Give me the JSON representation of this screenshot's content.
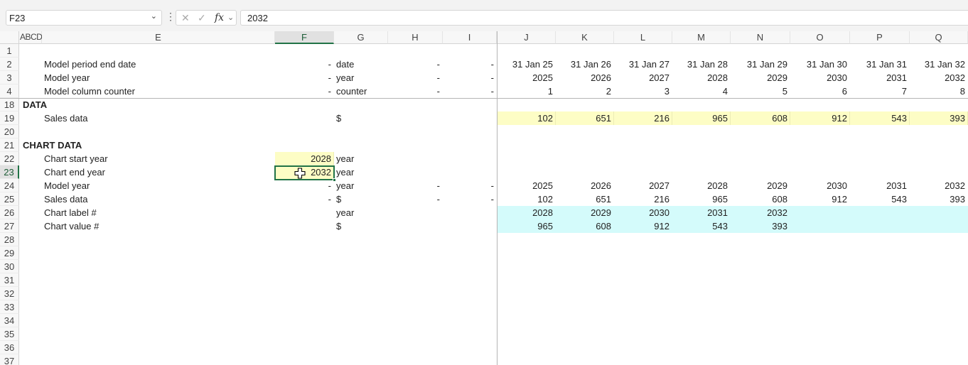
{
  "formula_bar": {
    "name_box": "F23",
    "cancel_glyph": "✕",
    "enter_glyph": "✓",
    "fx_label": "fx",
    "formula_value": "2032"
  },
  "columns": [
    "ABCD",
    "E",
    "F",
    "G",
    "H",
    "I",
    "J",
    "K",
    "L",
    "M",
    "N",
    "O",
    "P",
    "Q"
  ],
  "rows": [
    "1",
    "2",
    "3",
    "4",
    "18",
    "19",
    "20",
    "21",
    "22",
    "23",
    "24",
    "25",
    "26",
    "27",
    "28",
    "29",
    "30",
    "31",
    "32",
    "33",
    "34",
    "35",
    "36",
    "37"
  ],
  "selected": {
    "column": "F",
    "row": "23"
  },
  "sheet": {
    "row2": {
      "label": "Model period end date",
      "f": "-",
      "unit": "date",
      "h": "-",
      "i": "-",
      "values": [
        "31 Jan 25",
        "31 Jan 26",
        "31 Jan 27",
        "31 Jan 28",
        "31 Jan 29",
        "31 Jan 30",
        "31 Jan 31",
        "31 Jan 32"
      ]
    },
    "row3": {
      "label": "Model year",
      "f": "-",
      "unit": "year",
      "h": "-",
      "i": "-",
      "values": [
        "2025",
        "2026",
        "2027",
        "2028",
        "2029",
        "2030",
        "2031",
        "2032"
      ]
    },
    "row4": {
      "label": "Model column counter",
      "f": "-",
      "unit": "counter",
      "h": "-",
      "i": "-",
      "values": [
        "1",
        "2",
        "3",
        "4",
        "5",
        "6",
        "7",
        "8"
      ]
    },
    "row18": {
      "heading": "DATA"
    },
    "row19": {
      "label": "Sales data",
      "unit": "$",
      "values": [
        "102",
        "651",
        "216",
        "965",
        "608",
        "912",
        "543",
        "393"
      ]
    },
    "row21": {
      "heading": "CHART DATA"
    },
    "row22": {
      "label": "Chart start year",
      "f": "2028",
      "unit": "year"
    },
    "row23": {
      "label": "Chart end year",
      "f": "2032",
      "unit": "year"
    },
    "row24": {
      "label": "Model year",
      "f": "-",
      "unit": "year",
      "h": "-",
      "i": "-",
      "values": [
        "2025",
        "2026",
        "2027",
        "2028",
        "2029",
        "2030",
        "2031",
        "2032"
      ]
    },
    "row25": {
      "label": "Sales data",
      "f": "-",
      "unit": "$",
      "h": "-",
      "i": "-",
      "values": [
        "102",
        "651",
        "216",
        "965",
        "608",
        "912",
        "543",
        "393"
      ]
    },
    "row26": {
      "label": "Chart label #",
      "unit": "year",
      "values": [
        "2028",
        "2029",
        "2030",
        "2031",
        "2032"
      ]
    },
    "row27": {
      "label": "Chart value #",
      "unit": "$",
      "values": [
        "965",
        "608",
        "912",
        "543",
        "393"
      ]
    }
  },
  "colors": {
    "input_fill": "#fdfdc5",
    "chart_fill": "#d4fbfb",
    "select_green": "#217346"
  }
}
